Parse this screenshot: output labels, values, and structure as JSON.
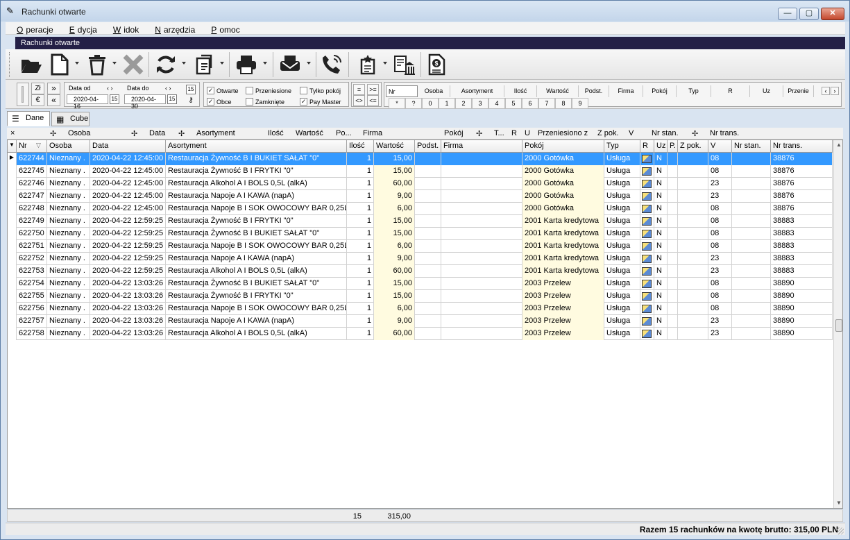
{
  "window": {
    "title": "Rachunki otwarte",
    "min": "—",
    "max": "▢",
    "close": "✕"
  },
  "menu": [
    {
      "u": "O",
      "rest": "peracje"
    },
    {
      "u": "E",
      "rest": "dycja"
    },
    {
      "u": "W",
      "rest": "idok"
    },
    {
      "u": "N",
      "rest": "arzędzia"
    },
    {
      "u": "P",
      "rest": "omoc"
    }
  ],
  "panel_title": "Rachunki otwarte",
  "toolbar_icons": [
    "open-folder-icon",
    "new-document-icon",
    "delete-icon",
    "cancel-icon",
    "refresh-icon",
    "transfer-icon",
    "print-icon",
    "mail-icon",
    "phone-icon",
    "bookmark-icon",
    "bank-icon",
    "invoice-icon"
  ],
  "filter": {
    "currency_top": "Zł",
    "currency_bottom": "€",
    "nav_forward": "»",
    "nav_back": "«",
    "date_from_label": "Data od",
    "date_to_label": "Data do",
    "date_from": "2020-04-16",
    "date_to": "2020-04-30",
    "cal": "15",
    "arrows": "‹  ›",
    "checks": [
      {
        "label": "Otwarte",
        "checked": true
      },
      {
        "label": "Obce",
        "checked": true
      },
      {
        "label": "Przeniesione",
        "checked": false
      },
      {
        "label": "Zamknięte",
        "checked": false
      },
      {
        "label": "Tylko pokój",
        "checked": false
      },
      {
        "label": "Pay Master",
        "checked": true
      }
    ],
    "operators": [
      "=",
      ">=",
      "<>",
      "<="
    ],
    "field_headers": [
      "Nr",
      "Osoba",
      "Asortyment",
      "Ilość",
      "Wartość",
      "Podst.",
      "Firma",
      "Pokój",
      "Typ",
      "R",
      "Uz",
      "Przenie"
    ],
    "digits": [
      "*",
      "?",
      "0",
      "1",
      "2",
      "3",
      "4",
      "5",
      "6",
      "7",
      "8",
      "9"
    ]
  },
  "tabs": [
    {
      "label": "Dane",
      "icon": "list-icon"
    },
    {
      "label": "Cube",
      "icon": "cube-icon"
    }
  ],
  "group_headers": [
    "Osoba",
    "Data",
    "Asortyment",
    "Ilość",
    "Wartość",
    "Po...",
    "Firma",
    "Pokój",
    "T...",
    "R",
    "U",
    "Przeniesiono z",
    "Z pok.",
    "V",
    "Nr stan.",
    "Nr trans."
  ],
  "columns": [
    "Nr",
    "Osoba",
    "Data",
    "Asortyment",
    "Ilość",
    "Wartość",
    "Podst.",
    "Firma",
    "Pokój",
    "Typ",
    "R",
    "Uz",
    "P.",
    "Z pok.",
    "V",
    "Nr stan.",
    "Nr trans."
  ],
  "rows": [
    {
      "nr": "622744",
      "osoba": "Nieznany .",
      "data": "2020-04-22 12:45:00",
      "asort": "Restauracja Żywność B I BUKIET SAŁAT \"0\"",
      "ilosc": "1",
      "wartosc": "15,00",
      "pokoj": "2000 Gotówka",
      "typ": "Usługa",
      "uz": "N",
      "v": "08",
      "trans": "38876"
    },
    {
      "nr": "622745",
      "osoba": "Nieznany .",
      "data": "2020-04-22 12:45:00",
      "asort": "Restauracja Żywność B I FRYTKI \"0\"",
      "ilosc": "1",
      "wartosc": "15,00",
      "pokoj": "2000 Gotówka",
      "typ": "Usługa",
      "uz": "N",
      "v": "08",
      "trans": "38876"
    },
    {
      "nr": "622746",
      "osoba": "Nieznany .",
      "data": "2020-04-22 12:45:00",
      "asort": "Restauracja Alkohol A I BOLS 0,5L (alkA)",
      "ilosc": "1",
      "wartosc": "60,00",
      "pokoj": "2000 Gotówka",
      "typ": "Usługa",
      "uz": "N",
      "v": "23",
      "trans": "38876"
    },
    {
      "nr": "622747",
      "osoba": "Nieznany .",
      "data": "2020-04-22 12:45:00",
      "asort": "Restauracja Napoje A I KAWA (napA)",
      "ilosc": "1",
      "wartosc": "9,00",
      "pokoj": "2000 Gotówka",
      "typ": "Usługa",
      "uz": "N",
      "v": "23",
      "trans": "38876"
    },
    {
      "nr": "622748",
      "osoba": "Nieznany .",
      "data": "2020-04-22 12:45:00",
      "asort": "Restauracja Napoje B I SOK OWOCOWY BAR 0,25L",
      "ilosc": "1",
      "wartosc": "6,00",
      "pokoj": "2000 Gotówka",
      "typ": "Usługa",
      "uz": "N",
      "v": "08",
      "trans": "38876"
    },
    {
      "nr": "622749",
      "osoba": "Nieznany .",
      "data": "2020-04-22 12:59:25",
      "asort": "Restauracja Żywność B I FRYTKI \"0\"",
      "ilosc": "1",
      "wartosc": "15,00",
      "pokoj": "2001 Karta kredytowa",
      "typ": "Usługa",
      "uz": "N",
      "v": "08",
      "trans": "38883"
    },
    {
      "nr": "622750",
      "osoba": "Nieznany .",
      "data": "2020-04-22 12:59:25",
      "asort": "Restauracja Żywność B I BUKIET SAŁAT \"0\"",
      "ilosc": "1",
      "wartosc": "15,00",
      "pokoj": "2001 Karta kredytowa",
      "typ": "Usługa",
      "uz": "N",
      "v": "08",
      "trans": "38883"
    },
    {
      "nr": "622751",
      "osoba": "Nieznany .",
      "data": "2020-04-22 12:59:25",
      "asort": "Restauracja Napoje B I SOK OWOCOWY BAR 0,25L",
      "ilosc": "1",
      "wartosc": "6,00",
      "pokoj": "2001 Karta kredytowa",
      "typ": "Usługa",
      "uz": "N",
      "v": "08",
      "trans": "38883"
    },
    {
      "nr": "622752",
      "osoba": "Nieznany .",
      "data": "2020-04-22 12:59:25",
      "asort": "Restauracja Napoje A I KAWA (napA)",
      "ilosc": "1",
      "wartosc": "9,00",
      "pokoj": "2001 Karta kredytowa",
      "typ": "Usługa",
      "uz": "N",
      "v": "23",
      "trans": "38883"
    },
    {
      "nr": "622753",
      "osoba": "Nieznany .",
      "data": "2020-04-22 12:59:25",
      "asort": "Restauracja Alkohol A I BOLS 0,5L (alkA)",
      "ilosc": "1",
      "wartosc": "60,00",
      "pokoj": "2001 Karta kredytowa",
      "typ": "Usługa",
      "uz": "N",
      "v": "23",
      "trans": "38883"
    },
    {
      "nr": "622754",
      "osoba": "Nieznany .",
      "data": "2020-04-22 13:03:26",
      "asort": "Restauracja Żywność B I BUKIET SAŁAT \"0\"",
      "ilosc": "1",
      "wartosc": "15,00",
      "pokoj": "2003 Przelew",
      "typ": "Usługa",
      "uz": "N",
      "v": "08",
      "trans": "38890"
    },
    {
      "nr": "622755",
      "osoba": "Nieznany .",
      "data": "2020-04-22 13:03:26",
      "asort": "Restauracja Żywność B I FRYTKI \"0\"",
      "ilosc": "1",
      "wartosc": "15,00",
      "pokoj": "2003 Przelew",
      "typ": "Usługa",
      "uz": "N",
      "v": "08",
      "trans": "38890"
    },
    {
      "nr": "622756",
      "osoba": "Nieznany .",
      "data": "2020-04-22 13:03:26",
      "asort": "Restauracja Napoje B I SOK OWOCOWY BAR 0,25L",
      "ilosc": "1",
      "wartosc": "6,00",
      "pokoj": "2003 Przelew",
      "typ": "Usługa",
      "uz": "N",
      "v": "08",
      "trans": "38890"
    },
    {
      "nr": "622757",
      "osoba": "Nieznany .",
      "data": "2020-04-22 13:03:26",
      "asort": "Restauracja Napoje A I KAWA (napA)",
      "ilosc": "1",
      "wartosc": "9,00",
      "pokoj": "2003 Przelew",
      "typ": "Usługa",
      "uz": "N",
      "v": "23",
      "trans": "38890"
    },
    {
      "nr": "622758",
      "osoba": "Nieznany .",
      "data": "2020-04-22 13:03:26",
      "asort": "Restauracja Alkohol A I BOLS 0,5L (alkA)",
      "ilosc": "1",
      "wartosc": "60,00",
      "pokoj": "2003 Przelew",
      "typ": "Usługa",
      "uz": "N",
      "v": "23",
      "trans": "38890"
    }
  ],
  "selected_row": 0,
  "totals": {
    "ilosc": "15",
    "wartosc": "315,00"
  },
  "status": "Razem 15 rachunków na kwotę brutto:  315,00  PLN",
  "colors": {
    "selection": "#3399ff",
    "panel_title": "#242046",
    "highlight_column": "#fffbe0"
  }
}
